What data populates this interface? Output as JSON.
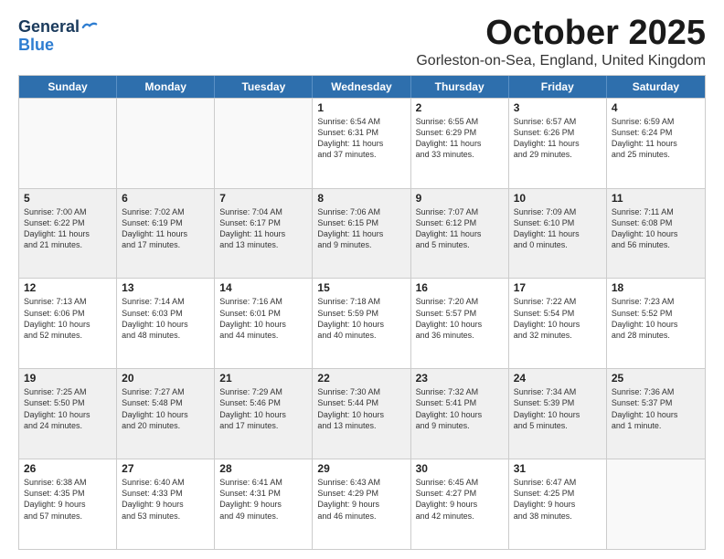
{
  "logo": {
    "line1": "General",
    "line2": "Blue"
  },
  "title": "October 2025",
  "location": "Gorleston-on-Sea, England, United Kingdom",
  "days_of_week": [
    "Sunday",
    "Monday",
    "Tuesday",
    "Wednesday",
    "Thursday",
    "Friday",
    "Saturday"
  ],
  "weeks": [
    [
      {
        "day": "",
        "empty": true
      },
      {
        "day": "",
        "empty": true
      },
      {
        "day": "",
        "empty": true
      },
      {
        "day": "1",
        "lines": [
          "Sunrise: 6:54 AM",
          "Sunset: 6:31 PM",
          "Daylight: 11 hours",
          "and 37 minutes."
        ]
      },
      {
        "day": "2",
        "lines": [
          "Sunrise: 6:55 AM",
          "Sunset: 6:29 PM",
          "Daylight: 11 hours",
          "and 33 minutes."
        ]
      },
      {
        "day": "3",
        "lines": [
          "Sunrise: 6:57 AM",
          "Sunset: 6:26 PM",
          "Daylight: 11 hours",
          "and 29 minutes."
        ]
      },
      {
        "day": "4",
        "lines": [
          "Sunrise: 6:59 AM",
          "Sunset: 6:24 PM",
          "Daylight: 11 hours",
          "and 25 minutes."
        ]
      }
    ],
    [
      {
        "day": "5",
        "lines": [
          "Sunrise: 7:00 AM",
          "Sunset: 6:22 PM",
          "Daylight: 11 hours",
          "and 21 minutes."
        ]
      },
      {
        "day": "6",
        "lines": [
          "Sunrise: 7:02 AM",
          "Sunset: 6:19 PM",
          "Daylight: 11 hours",
          "and 17 minutes."
        ]
      },
      {
        "day": "7",
        "lines": [
          "Sunrise: 7:04 AM",
          "Sunset: 6:17 PM",
          "Daylight: 11 hours",
          "and 13 minutes."
        ]
      },
      {
        "day": "8",
        "lines": [
          "Sunrise: 7:06 AM",
          "Sunset: 6:15 PM",
          "Daylight: 11 hours",
          "and 9 minutes."
        ]
      },
      {
        "day": "9",
        "lines": [
          "Sunrise: 7:07 AM",
          "Sunset: 6:12 PM",
          "Daylight: 11 hours",
          "and 5 minutes."
        ]
      },
      {
        "day": "10",
        "lines": [
          "Sunrise: 7:09 AM",
          "Sunset: 6:10 PM",
          "Daylight: 11 hours",
          "and 0 minutes."
        ]
      },
      {
        "day": "11",
        "lines": [
          "Sunrise: 7:11 AM",
          "Sunset: 6:08 PM",
          "Daylight: 10 hours",
          "and 56 minutes."
        ]
      }
    ],
    [
      {
        "day": "12",
        "lines": [
          "Sunrise: 7:13 AM",
          "Sunset: 6:06 PM",
          "Daylight: 10 hours",
          "and 52 minutes."
        ]
      },
      {
        "day": "13",
        "lines": [
          "Sunrise: 7:14 AM",
          "Sunset: 6:03 PM",
          "Daylight: 10 hours",
          "and 48 minutes."
        ]
      },
      {
        "day": "14",
        "lines": [
          "Sunrise: 7:16 AM",
          "Sunset: 6:01 PM",
          "Daylight: 10 hours",
          "and 44 minutes."
        ]
      },
      {
        "day": "15",
        "lines": [
          "Sunrise: 7:18 AM",
          "Sunset: 5:59 PM",
          "Daylight: 10 hours",
          "and 40 minutes."
        ]
      },
      {
        "day": "16",
        "lines": [
          "Sunrise: 7:20 AM",
          "Sunset: 5:57 PM",
          "Daylight: 10 hours",
          "and 36 minutes."
        ]
      },
      {
        "day": "17",
        "lines": [
          "Sunrise: 7:22 AM",
          "Sunset: 5:54 PM",
          "Daylight: 10 hours",
          "and 32 minutes."
        ]
      },
      {
        "day": "18",
        "lines": [
          "Sunrise: 7:23 AM",
          "Sunset: 5:52 PM",
          "Daylight: 10 hours",
          "and 28 minutes."
        ]
      }
    ],
    [
      {
        "day": "19",
        "lines": [
          "Sunrise: 7:25 AM",
          "Sunset: 5:50 PM",
          "Daylight: 10 hours",
          "and 24 minutes."
        ]
      },
      {
        "day": "20",
        "lines": [
          "Sunrise: 7:27 AM",
          "Sunset: 5:48 PM",
          "Daylight: 10 hours",
          "and 20 minutes."
        ]
      },
      {
        "day": "21",
        "lines": [
          "Sunrise: 7:29 AM",
          "Sunset: 5:46 PM",
          "Daylight: 10 hours",
          "and 17 minutes."
        ]
      },
      {
        "day": "22",
        "lines": [
          "Sunrise: 7:30 AM",
          "Sunset: 5:44 PM",
          "Daylight: 10 hours",
          "and 13 minutes."
        ]
      },
      {
        "day": "23",
        "lines": [
          "Sunrise: 7:32 AM",
          "Sunset: 5:41 PM",
          "Daylight: 10 hours",
          "and 9 minutes."
        ]
      },
      {
        "day": "24",
        "lines": [
          "Sunrise: 7:34 AM",
          "Sunset: 5:39 PM",
          "Daylight: 10 hours",
          "and 5 minutes."
        ]
      },
      {
        "day": "25",
        "lines": [
          "Sunrise: 7:36 AM",
          "Sunset: 5:37 PM",
          "Daylight: 10 hours",
          "and 1 minute."
        ]
      }
    ],
    [
      {
        "day": "26",
        "lines": [
          "Sunrise: 6:38 AM",
          "Sunset: 4:35 PM",
          "Daylight: 9 hours",
          "and 57 minutes."
        ]
      },
      {
        "day": "27",
        "lines": [
          "Sunrise: 6:40 AM",
          "Sunset: 4:33 PM",
          "Daylight: 9 hours",
          "and 53 minutes."
        ]
      },
      {
        "day": "28",
        "lines": [
          "Sunrise: 6:41 AM",
          "Sunset: 4:31 PM",
          "Daylight: 9 hours",
          "and 49 minutes."
        ]
      },
      {
        "day": "29",
        "lines": [
          "Sunrise: 6:43 AM",
          "Sunset: 4:29 PM",
          "Daylight: 9 hours",
          "and 46 minutes."
        ]
      },
      {
        "day": "30",
        "lines": [
          "Sunrise: 6:45 AM",
          "Sunset: 4:27 PM",
          "Daylight: 9 hours",
          "and 42 minutes."
        ]
      },
      {
        "day": "31",
        "lines": [
          "Sunrise: 6:47 AM",
          "Sunset: 4:25 PM",
          "Daylight: 9 hours",
          "and 38 minutes."
        ]
      },
      {
        "day": "",
        "empty": true
      }
    ]
  ]
}
